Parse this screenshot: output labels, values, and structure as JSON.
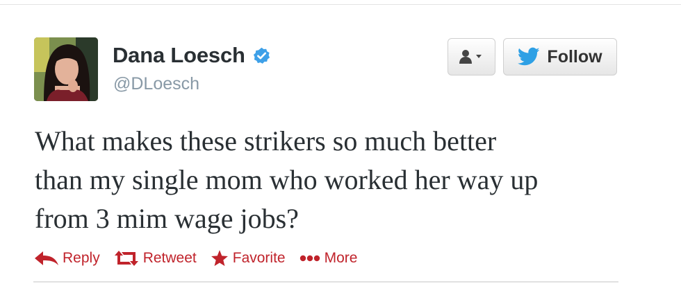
{
  "tweet": {
    "author": {
      "display_name": "Dana Loesch",
      "handle": "@DLoesch",
      "verified": true
    },
    "text_lines": [
      "What makes these strikers so much better",
      "than my single mom who worked her way up",
      "from 3 mim wage jobs?"
    ],
    "actions": {
      "reply": "Reply",
      "retweet": "Retweet",
      "favorite": "Favorite",
      "more": "More"
    }
  },
  "header_buttons": {
    "follow_label": "Follow"
  },
  "icons": {
    "verified": "verified-badge-icon",
    "user_menu": "user-dropdown-icon",
    "follow": "twitter-bird-icon",
    "reply": "reply-arrow-icon",
    "retweet": "retweet-icon",
    "favorite": "star-icon",
    "more": "more-dots-icon"
  },
  "colors": {
    "action": "#c0232b",
    "verified": "#3ea0e8",
    "bird": "#2ea0e5",
    "name": "#292f33",
    "handle": "#8899a6"
  }
}
